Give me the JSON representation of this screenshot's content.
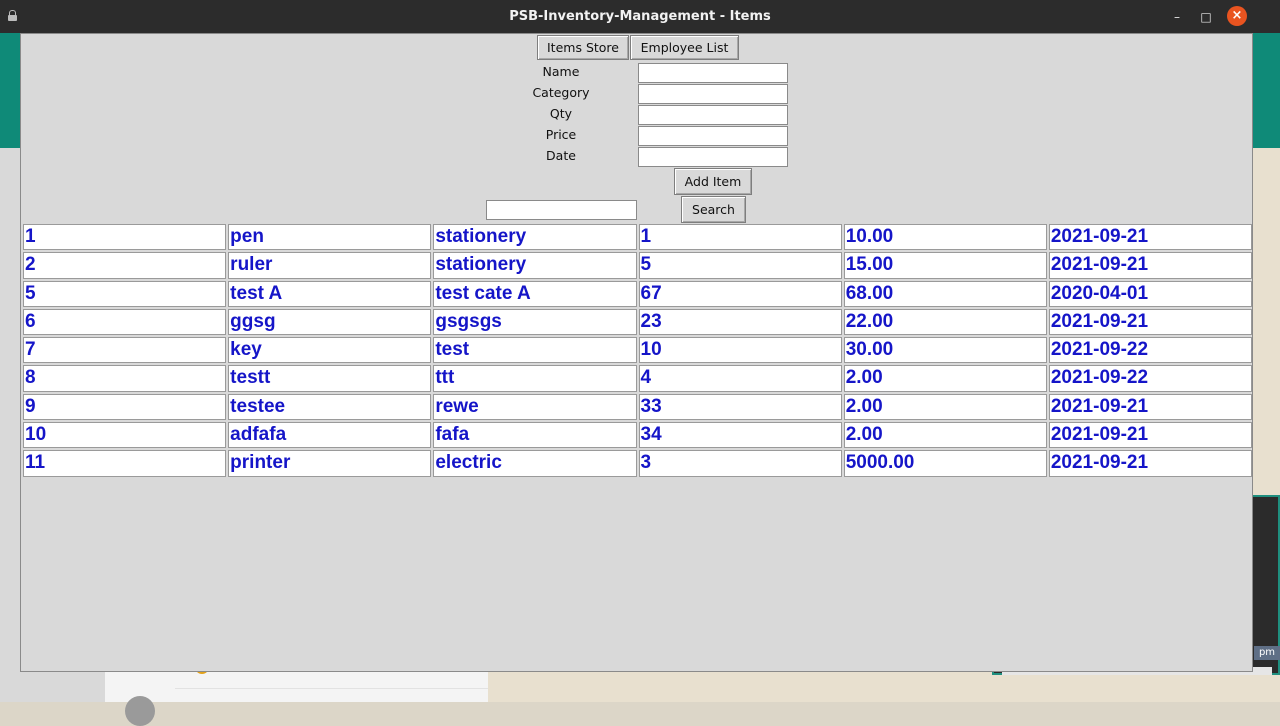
{
  "window": {
    "title": "PSB-Inventory-Management - Items",
    "minimize_glyph": "–",
    "maximize_glyph": "□",
    "close_glyph": "×"
  },
  "nav": {
    "items_store": "Items Store",
    "employee_list": "Employee List"
  },
  "form": {
    "name_label": "Name",
    "category_label": "Category",
    "qty_label": "Qty",
    "price_label": "Price",
    "date_label": "Date",
    "name_value": "",
    "category_value": "",
    "qty_value": "",
    "price_value": "",
    "date_value": "",
    "add_button": "Add Item"
  },
  "search": {
    "value": "",
    "button": "Search"
  },
  "items": [
    [
      "1",
      "pen",
      "stationery",
      "1",
      "10.00",
      "2021-09-21"
    ],
    [
      "2",
      "ruler",
      "stationery",
      "5",
      "15.00",
      "2021-09-21"
    ],
    [
      "5",
      "test A",
      "test cate A",
      "67",
      "68.00",
      "2020-04-01"
    ],
    [
      "6",
      "ggsg",
      "gsgsgs",
      "23",
      "22.00",
      "2021-09-21"
    ],
    [
      "7",
      "key",
      "test",
      "10",
      "30.00",
      "2021-09-22"
    ],
    [
      "8",
      "testt",
      "ttt",
      "4",
      "2.00",
      "2021-09-22"
    ],
    [
      "9",
      "testee",
      "rewe",
      "33",
      "2.00",
      "2021-09-21"
    ],
    [
      "10",
      "adfafa",
      "fafa",
      "34",
      "2.00",
      "2021-09-21"
    ],
    [
      "11",
      "printer",
      "electric",
      "3",
      "5000.00",
      "2021-09-21"
    ]
  ],
  "background": {
    "clock_fragment": "pm"
  },
  "colors": {
    "titlebar": "#2c2c2c",
    "close_button": "#e95420",
    "cell_text": "#1515c8",
    "window_bg": "#d9d9d9"
  }
}
